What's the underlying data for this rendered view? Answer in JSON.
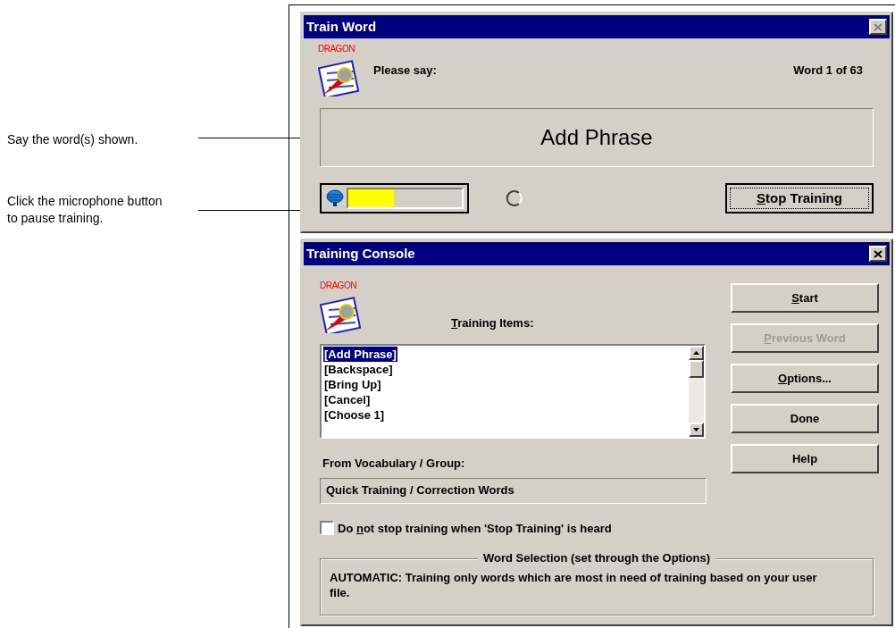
{
  "callouts": [
    {
      "text": "Say the word(s) shown."
    },
    {
      "text": "Click the microphone button to pause training."
    }
  ],
  "train_word": {
    "title": "Train Word",
    "logo_text": "DRAGON",
    "prompt": "Please say:",
    "counter": "Word 1 of 63",
    "phrase": "Add Phrase",
    "mic": {
      "level": 0.4
    },
    "stop_button": {
      "key": "S",
      "after": "top Training"
    }
  },
  "training_console": {
    "title": "Training Console",
    "logo_text": "DRAGON",
    "items_label": {
      "key": "T",
      "after": "raining Items:"
    },
    "items": [
      {
        "label": "[Add Phrase]",
        "selected": true
      },
      {
        "label": "[Backspace]",
        "selected": false
      },
      {
        "label": "[Bring Up]",
        "selected": false
      },
      {
        "label": "[Cancel]",
        "selected": false
      },
      {
        "label": "[Choose 1]",
        "selected": false
      }
    ],
    "buttons": [
      {
        "label": {
          "key": "S",
          "after": "tart"
        },
        "disabled": false
      },
      {
        "label": {
          "key": "P",
          "after": "revious Word"
        },
        "disabled": true
      },
      {
        "label": {
          "key": "O",
          "after": "ptions..."
        },
        "disabled": false
      },
      {
        "label": {
          "after": "Done"
        },
        "disabled": false
      },
      {
        "label": {
          "after": "Help"
        },
        "disabled": false
      }
    ],
    "vocabulary_label": "From Vocabulary / Group:",
    "vocabulary": "Quick Training / Correction Words",
    "dont_stop": {
      "label": {
        "before": "Do ",
        "key": "n",
        "after": "ot stop training when 'Stop Training' is heard"
      },
      "checked": false
    },
    "word_selection": {
      "title": "Word Selection (set through the Options)",
      "text": "AUTOMATIC: Training only words which are most in need of training based on your user file."
    }
  }
}
